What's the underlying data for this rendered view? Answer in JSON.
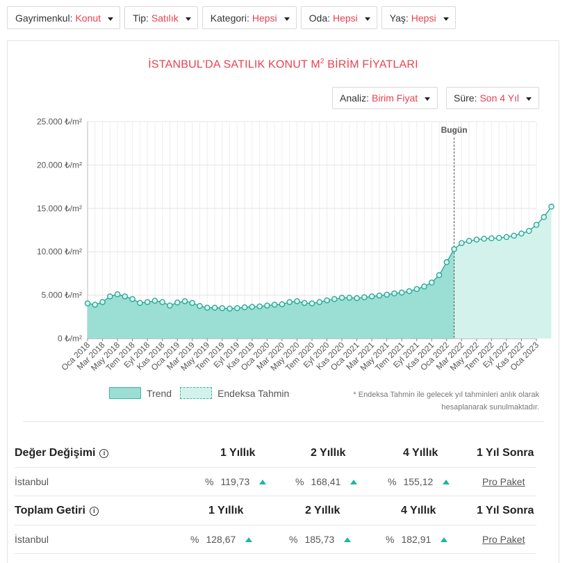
{
  "filters": [
    {
      "label": "Gayrimenkul:",
      "value": "Konut"
    },
    {
      "label": "Tip:",
      "value": "Satılık"
    },
    {
      "label": "Kategori:",
      "value": "Hepsi"
    },
    {
      "label": "Oda:",
      "value": "Hepsi"
    },
    {
      "label": "Yaş:",
      "value": "Hepsi"
    }
  ],
  "title": "İSTANBUL'DA SATILIK KONUT M",
  "title_sup": "2",
  "title_tail": " BİRİM FİYATLARI",
  "analysis": {
    "label": "Analiz:",
    "value": "Birim Fiyat"
  },
  "period": {
    "label": "Süre:",
    "value": "Son 4 Yıl"
  },
  "legend": {
    "trend": "Trend",
    "forecast": "Endeksa Tahmin"
  },
  "note": "* Endeksa Tahmin ile gelecek yıl tahminleri anlık olarak hesaplanarak sunulmaktadır.",
  "value_change": {
    "title": "Değer Değişimi",
    "cols": [
      "1 Yıllık",
      "2 Yıllık",
      "4 Yıllık",
      "1 Yıl Sonra"
    ],
    "row": {
      "name": "İstanbul",
      "v1": "119,73",
      "v2": "168,41",
      "v3": "155,12",
      "link": "Pro Paket"
    }
  },
  "total_return": {
    "title": "Toplam Getiri",
    "cols": [
      "1 Yıllık",
      "2 Yıllık",
      "4 Yıllık",
      "1 Yıl Sonra"
    ],
    "row": {
      "name": "İstanbul",
      "v1": "128,67",
      "v2": "185,73",
      "v3": "182,91",
      "link": "Pro Paket"
    }
  },
  "pct_symbol": "%",
  "colors": {
    "accent": "#e8414f",
    "trend_fill": "#9bded3",
    "forecast_fill": "#d4f2ec",
    "line": "#1fa592"
  },
  "chart_data": {
    "type": "area",
    "ylim": [
      0,
      25000
    ],
    "ytick_values": [
      0,
      5000,
      10000,
      15000,
      20000,
      25000
    ],
    "ytick_labels": [
      "0 ₺/m²",
      "5.000 ₺/m²",
      "10.000 ₺/m²",
      "15.000 ₺/m²",
      "20.000 ₺/m²",
      "25.000 ₺/m²"
    ],
    "x": [
      "Oca 2018",
      "Şub 2018",
      "Mar 2018",
      "Nis 2018",
      "May 2018",
      "Haz 2018",
      "Tem 2018",
      "Ağu 2018",
      "Eyl 2018",
      "Eki 2018",
      "Kas 2018",
      "Ara 2018",
      "Oca 2019",
      "Şub 2019",
      "Mar 2019",
      "Nis 2019",
      "May 2019",
      "Haz 2019",
      "Tem 2019",
      "Ağu 2019",
      "Eyl 2019",
      "Eki 2019",
      "Kas 2019",
      "Ara 2019",
      "Oca 2020",
      "Şub 2020",
      "Mar 2020",
      "Nis 2020",
      "May 2020",
      "Haz 2020",
      "Tem 2020",
      "Ağu 2020",
      "Eyl 2020",
      "Eki 2020",
      "Kas 2020",
      "Ara 2020",
      "Oca 2021",
      "Şub 2021",
      "Mar 2021",
      "Nis 2021",
      "May 2021",
      "Haz 2021",
      "Tem 2021",
      "Ağu 2021",
      "Eyl 2021",
      "Eki 2021",
      "Kas 2021",
      "Ara 2021",
      "Oca 2022",
      "Şub 2022",
      "Mar 2022",
      "Nis 2022",
      "May 2022",
      "Haz 2022",
      "Tem 2022",
      "Ağu 2022",
      "Eyl 2022",
      "Eki 2022",
      "Kas 2022",
      "Ara 2022",
      "Oca 2023"
    ],
    "xtick_labels": [
      "Oca 2018",
      "Mar 2018",
      "May 2018",
      "Tem 2018",
      "Eyl 2018",
      "Kas 2018",
      "Oca 2019",
      "Mar 2019",
      "May 2019",
      "Tem 2019",
      "Eyl 2019",
      "Kas 2019",
      "Oca 2020",
      "Mar 2020",
      "May 2020",
      "Tem 2020",
      "Eyl 2020",
      "Kas 2020",
      "Oca 2021",
      "Mar 2021",
      "May 2021",
      "Tem 2021",
      "Eyl 2021",
      "Kas 2021",
      "Oca 2022",
      "Mar 2022",
      "May 2022",
      "Tem 2022",
      "Eyl 2022",
      "Kas 2022",
      "Oca 2023"
    ],
    "series": [
      {
        "name": "Trend",
        "values": [
          4050,
          3900,
          4200,
          4850,
          5100,
          4850,
          4550,
          4100,
          4200,
          4350,
          4200,
          3800,
          4150,
          4300,
          4100,
          3750,
          3550,
          3550,
          3500,
          3450,
          3500,
          3600,
          3650,
          3700,
          3800,
          3900,
          3950,
          4200,
          4300,
          4100,
          4050,
          4200,
          4400,
          4550,
          4700,
          4700,
          4650,
          4750,
          4850,
          4950,
          5050,
          5200,
          5300,
          5450,
          5700,
          6000,
          6450,
          7300,
          8800,
          10300
        ]
      },
      {
        "name": "Endeksa Tahmin",
        "start_index": 49,
        "values": [
          10300,
          11000,
          11250,
          11400,
          11500,
          11550,
          11600,
          11700,
          11850,
          12100,
          12400,
          13100,
          14000,
          15200
        ]
      }
    ],
    "today_index": 49,
    "today_label": "Bugün"
  }
}
